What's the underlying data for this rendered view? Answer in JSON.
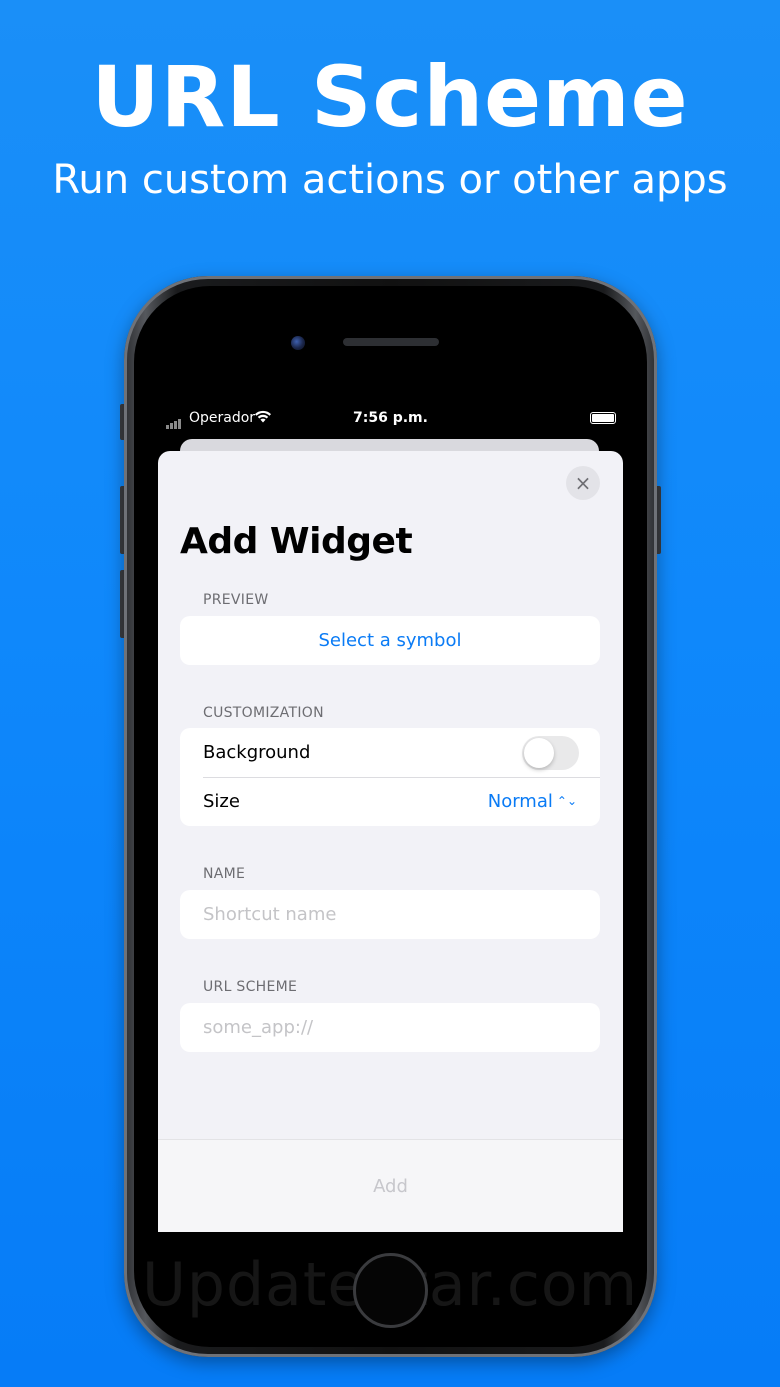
{
  "headline": "URL Scheme",
  "subheadline": "Run custom actions or other apps",
  "status_bar": {
    "carrier": "Operador",
    "time": "7:56 p.m."
  },
  "sheet": {
    "title": "Add Widget",
    "close_icon": "×",
    "preview": {
      "section_label": "PREVIEW",
      "select_symbol_label": "Select a symbol"
    },
    "customization": {
      "section_label": "CUSTOMIZATION",
      "background_label": "Background",
      "background_on": false,
      "size_label": "Size",
      "size_value": "Normal"
    },
    "name": {
      "section_label": "NAME",
      "placeholder": "Shortcut name",
      "value": ""
    },
    "url_scheme": {
      "section_label": "URL SCHEME",
      "placeholder": "some_app://",
      "value": ""
    },
    "add_button_label": "Add"
  },
  "watermark": "UpdateStar.com",
  "colors": {
    "background": "#0f88fb",
    "accent": "#0a7bf5",
    "sheet_bg": "#f2f2f7"
  }
}
